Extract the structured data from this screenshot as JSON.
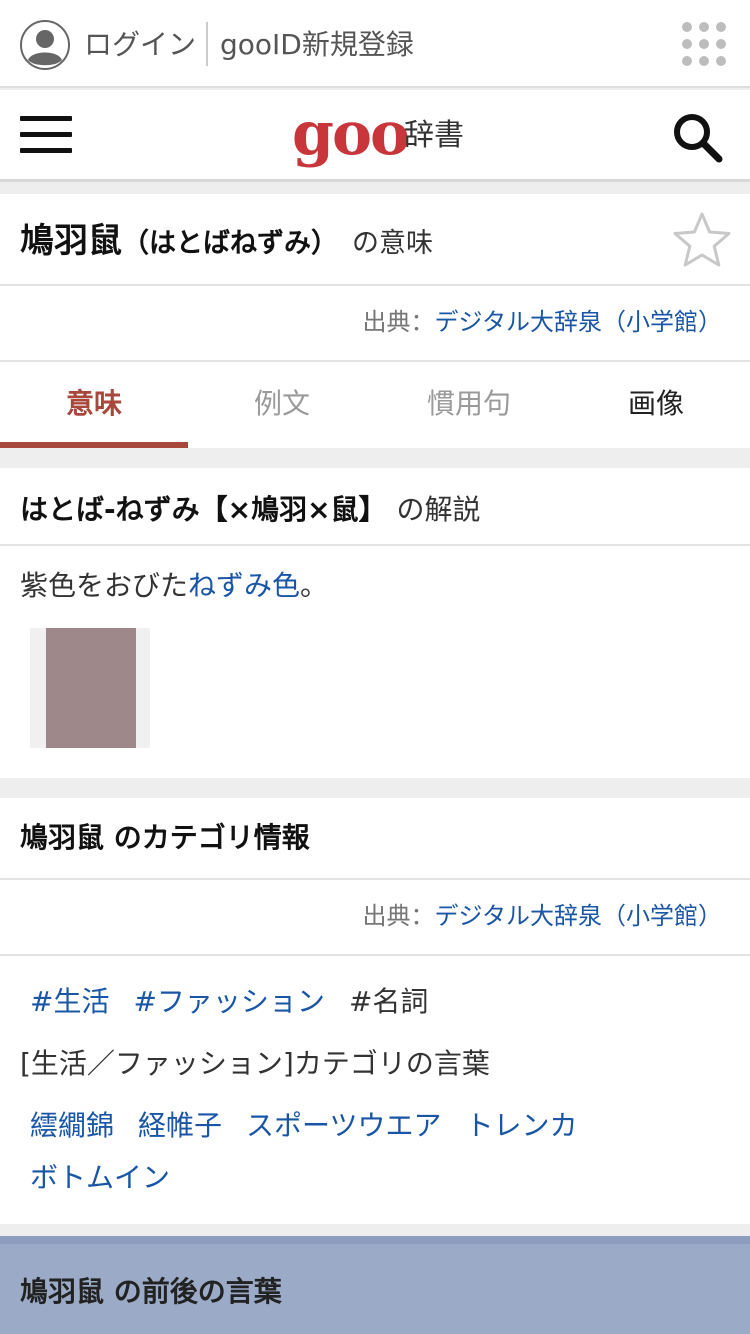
{
  "account": {
    "login": "ログイン",
    "register": "gooID新規登録"
  },
  "header": {
    "logo": "goo",
    "logo_suffix": "辞書"
  },
  "word": {
    "headword": "鳩羽鼠",
    "reading": "（はとばねずみ）",
    "meaning_suffix": "の意味"
  },
  "source": {
    "prefix": "出典：",
    "name": "デジタル大辞泉（小学館）"
  },
  "tabs": [
    {
      "label": "意味"
    },
    {
      "label": "例文"
    },
    {
      "label": "慣用句"
    },
    {
      "label": "画像"
    }
  ],
  "description": {
    "title": "はとば-ねずみ【×鳩羽×鼠】",
    "title_suffix": "の解説",
    "text_before": "紫色をおびた",
    "link": "ねずみ色",
    "text_after": "。",
    "swatch_color": "#9f8889"
  },
  "category": {
    "title": "鳩羽鼠 のカテゴリ情報",
    "tags": [
      "#生活",
      "#ファッション",
      "#名詞"
    ],
    "label": "[生活／ファッション]カテゴリの言葉",
    "words": [
      "繧繝錦",
      "経帷子",
      "スポーツウエア",
      "トレンカ",
      "ボトムイン"
    ]
  },
  "related": {
    "title": "鳩羽鼠 の前後の言葉"
  },
  "colors": {
    "brand": "#c8363c",
    "link": "#1a56a6",
    "active_tab": "#a8473b"
  }
}
